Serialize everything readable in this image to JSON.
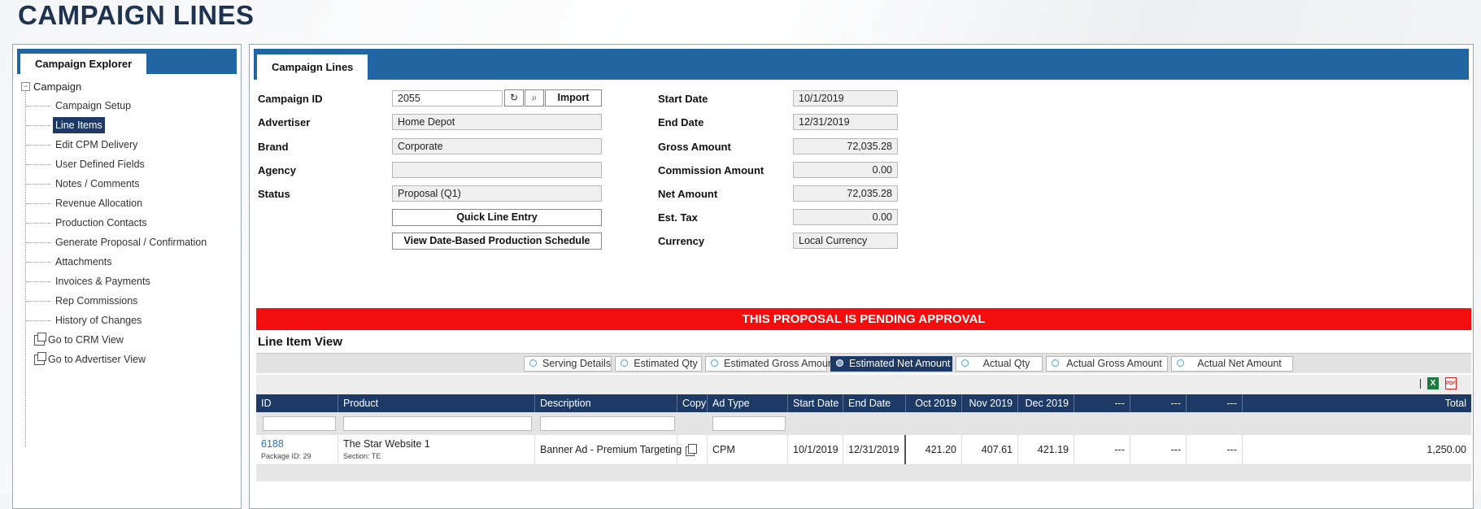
{
  "page": {
    "title": "CAMPAIGN LINES"
  },
  "explorer": {
    "tab": "Campaign Explorer",
    "root": "Campaign",
    "items": [
      {
        "label": "Campaign Setup",
        "active": false
      },
      {
        "label": "Line Items",
        "active": true
      },
      {
        "label": "Edit CPM Delivery",
        "active": false
      },
      {
        "label": "User Defined Fields",
        "active": false
      },
      {
        "label": "Notes / Comments",
        "active": false
      },
      {
        "label": "Revenue Allocation",
        "active": false
      },
      {
        "label": "Production Contacts",
        "active": false
      },
      {
        "label": "Generate Proposal / Confirmation",
        "active": false
      },
      {
        "label": "Attachments",
        "active": false
      },
      {
        "label": "Invoices & Payments",
        "active": false
      },
      {
        "label": "Rep Commissions",
        "active": false
      },
      {
        "label": "History of Changes",
        "active": false
      }
    ],
    "links": [
      "Go to CRM View",
      "Go to Advertiser View"
    ]
  },
  "main": {
    "tab": "Campaign Lines",
    "left_fields": {
      "campaign_id": {
        "label": "Campaign ID",
        "value": "2055"
      },
      "advertiser": {
        "label": "Advertiser",
        "value": "Home Depot"
      },
      "brand": {
        "label": "Brand",
        "value": "Corporate"
      },
      "agency": {
        "label": "Agency",
        "value": ""
      },
      "status": {
        "label": "Status",
        "value": "Proposal (Q1)"
      }
    },
    "import_label": "Import",
    "quick_line_entry_label": "Quick Line Entry",
    "view_schedule_label": "View Date-Based Production Schedule",
    "right_fields": {
      "start_date": {
        "label": "Start Date",
        "value": "10/1/2019"
      },
      "end_date": {
        "label": "End Date",
        "value": "12/31/2019"
      },
      "gross_amount": {
        "label": "Gross Amount",
        "value": "72,035.28"
      },
      "commission_amount": {
        "label": "Commission Amount",
        "value": "0.00"
      },
      "net_amount": {
        "label": "Net Amount",
        "value": "72,035.28"
      },
      "est_tax": {
        "label": "Est. Tax",
        "value": "0.00"
      },
      "currency": {
        "label": "Currency",
        "value": "Local Currency"
      }
    },
    "pending_banner": "THIS PROPOSAL IS PENDING APPROVAL",
    "line_item_view_title": "Line Item View",
    "view_options": [
      {
        "label": "Serving Details",
        "selected": false
      },
      {
        "label": "Estimated Qty",
        "selected": false
      },
      {
        "label": "Estimated Gross Amount",
        "selected": false
      },
      {
        "label": "Estimated Net Amount",
        "selected": true
      },
      {
        "label": "Actual Qty",
        "selected": false
      },
      {
        "label": "Actual Gross Amount",
        "selected": false
      },
      {
        "label": "Actual Net Amount",
        "selected": false
      }
    ],
    "accent_color": "#1d3a66",
    "banner_color": "#f30d0d"
  },
  "grid": {
    "columns": [
      "ID",
      "Product",
      "Description",
      "Copy",
      "Ad Type",
      "Start Date",
      "End Date",
      "Oct 2019",
      "Nov 2019",
      "Dec 2019",
      "---",
      "---",
      "---",
      "Total"
    ],
    "rows": [
      {
        "id": "6188",
        "package": "Package ID: 29",
        "product": "The Star Website 1",
        "section": "Section: TE",
        "description": "Banner Ad - Premium Targeting",
        "copy_icon": "copy-icon",
        "ad_type": "CPM",
        "start_date": "10/1/2019",
        "end_date": "12/31/2019",
        "oct": "421.20",
        "nov": "407.61",
        "dec": "421.19",
        "c1": "---",
        "c2": "---",
        "c3": "---",
        "total": "1,250.00"
      }
    ]
  }
}
